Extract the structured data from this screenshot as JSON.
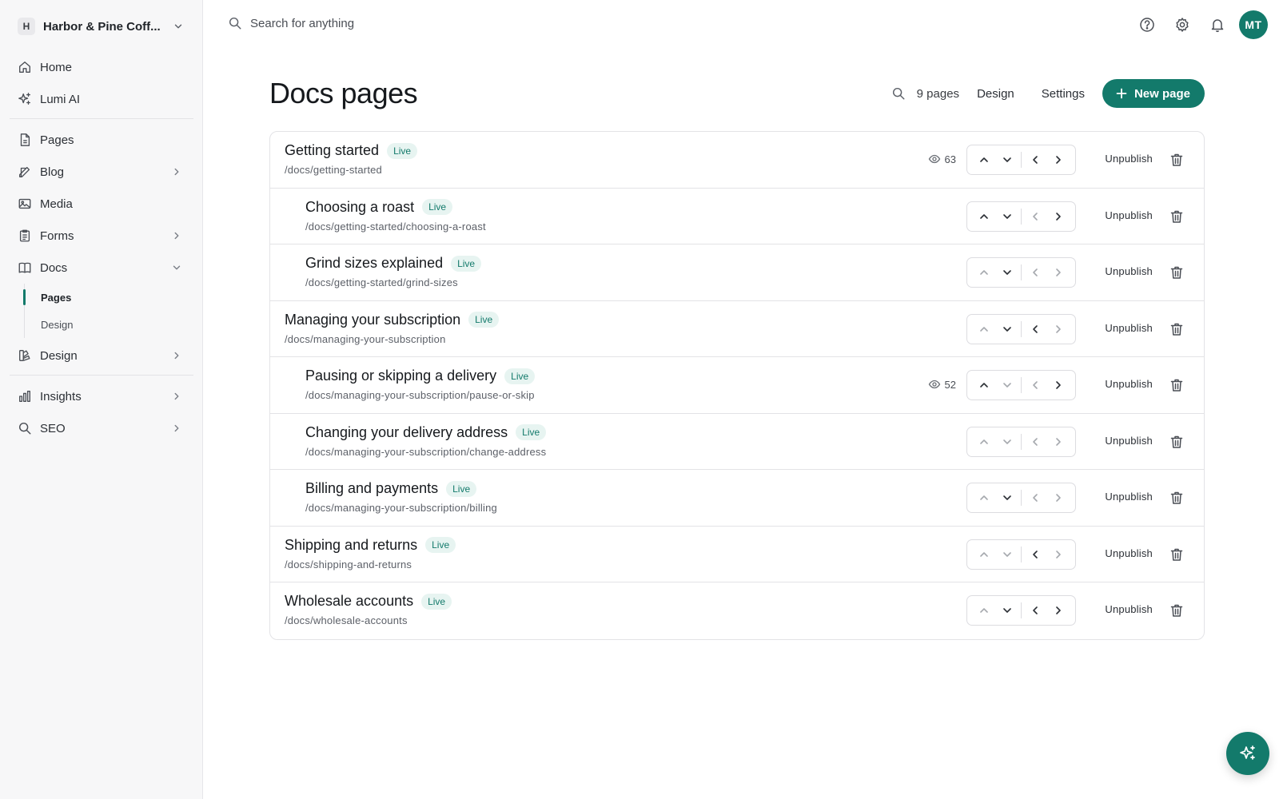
{
  "workspace": {
    "initial": "H",
    "name": "Harbor & Pine Coff..."
  },
  "sidebar": {
    "group1": [
      {
        "label": "Home",
        "icon": "home-icon"
      },
      {
        "label": "Lumi AI",
        "icon": "sparkles-icon"
      }
    ],
    "group2": [
      {
        "label": "Pages",
        "icon": "file-icon",
        "chevron": false
      },
      {
        "label": "Blog",
        "icon": "pencil-icon",
        "chevron": true
      },
      {
        "label": "Media",
        "icon": "image-icon",
        "chevron": false
      },
      {
        "label": "Forms",
        "icon": "clipboard-icon",
        "chevron": true
      },
      {
        "label": "Docs",
        "icon": "book-icon",
        "chevron": true,
        "expanded": true
      }
    ],
    "docs_sub": [
      {
        "label": "Pages",
        "active": true
      },
      {
        "label": "Design",
        "active": false
      }
    ],
    "group2b": [
      {
        "label": "Design",
        "icon": "palette-icon",
        "chevron": true
      }
    ],
    "group3": [
      {
        "label": "Insights",
        "icon": "bar-chart-icon",
        "chevron": true
      },
      {
        "label": "SEO",
        "icon": "search-icon",
        "chevron": true
      }
    ]
  },
  "topbar": {
    "search_placeholder": "Search for anything",
    "user_initials": "MT"
  },
  "header": {
    "title": "Docs pages",
    "count": "9 pages",
    "design_label": "Design",
    "settings_label": "Settings",
    "new_page_label": "New page"
  },
  "rows": [
    {
      "title": "Getting started",
      "badge": "Live",
      "slug": "/docs/getting-started",
      "indent": 0,
      "views": "63",
      "ctrls": [
        true,
        true,
        true,
        true
      ],
      "action": "Unpublish"
    },
    {
      "title": "Choosing a roast",
      "badge": "Live",
      "slug": "/docs/getting-started/choosing-a-roast",
      "indent": 1,
      "views": "",
      "ctrls": [
        true,
        true,
        false,
        true
      ],
      "action": "Unpublish"
    },
    {
      "title": "Grind sizes explained",
      "badge": "Live",
      "slug": "/docs/getting-started/grind-sizes",
      "indent": 1,
      "views": "",
      "ctrls": [
        false,
        true,
        false,
        false
      ],
      "action": "Unpublish"
    },
    {
      "title": "Managing your subscription",
      "badge": "Live",
      "slug": "/docs/managing-your-subscription",
      "indent": 0,
      "views": "",
      "ctrls": [
        false,
        true,
        true,
        false
      ],
      "action": "Unpublish"
    },
    {
      "title": "Pausing or skipping a delivery",
      "badge": "Live",
      "slug": "/docs/managing-your-subscription/pause-or-skip",
      "indent": 1,
      "views": "52",
      "ctrls": [
        true,
        false,
        false,
        true
      ],
      "action": "Unpublish"
    },
    {
      "title": "Changing your delivery address",
      "badge": "Live",
      "slug": "/docs/managing-your-subscription/change-address",
      "indent": 1,
      "views": "",
      "ctrls": [
        false,
        false,
        false,
        false
      ],
      "action": "Unpublish"
    },
    {
      "title": "Billing and payments",
      "badge": "Live",
      "slug": "/docs/managing-your-subscription/billing",
      "indent": 1,
      "views": "",
      "ctrls": [
        false,
        true,
        false,
        false
      ],
      "action": "Unpublish"
    },
    {
      "title": "Shipping and returns",
      "badge": "Live",
      "slug": "/docs/shipping-and-returns",
      "indent": 0,
      "views": "",
      "ctrls": [
        false,
        false,
        true,
        false
      ],
      "action": "Unpublish"
    },
    {
      "title": "Wholesale accounts",
      "badge": "Live",
      "slug": "/docs/wholesale-accounts",
      "indent": 0,
      "views": "",
      "ctrls": [
        false,
        true,
        true,
        true
      ],
      "action": "Unpublish"
    }
  ],
  "colors": {
    "accent": "#137a6b",
    "badge_bg": "#e7f4f1",
    "sidebar_bg": "#f7f7f8"
  }
}
